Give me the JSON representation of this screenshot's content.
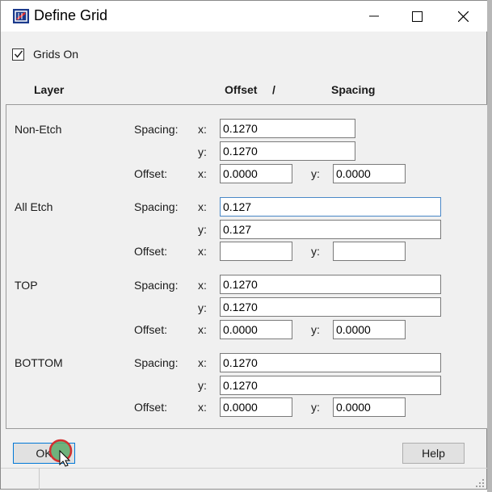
{
  "window": {
    "title": "Define Grid"
  },
  "grids_on": {
    "label": "Grids On",
    "checked": true
  },
  "headers": {
    "layer": "Layer",
    "offset": "Offset",
    "slash": "/",
    "spacing": "Spacing"
  },
  "labels": {
    "spacing": "Spacing:",
    "offset": "Offset:",
    "x": "x:",
    "y": "y:"
  },
  "layers": [
    {
      "name": "Non-Etch",
      "spacing_x": "0.1270",
      "spacing_y": "0.1270",
      "offset_x": "0.0000",
      "offset_y": "0.0000"
    },
    {
      "name": "All Etch",
      "spacing_x": "0.127",
      "spacing_y": "0.127",
      "offset_x": "",
      "offset_y": ""
    },
    {
      "name": "TOP",
      "spacing_x": "0.1270",
      "spacing_y": "0.1270",
      "offset_x": "0.0000",
      "offset_y": "0.0000"
    },
    {
      "name": "BOTTOM",
      "spacing_x": "0.1270",
      "spacing_y": "0.1270",
      "offset_x": "0.0000",
      "offset_y": "0.0000"
    }
  ],
  "buttons": {
    "ok": "OK",
    "help": "Help"
  },
  "icons": [
    "app-icon",
    "minimize-icon",
    "maximize-icon",
    "close-icon",
    "checkmark-icon",
    "mouse-cursor-icon",
    "resize-grip-icon"
  ],
  "colors": {
    "focus_border": "#4a88c7",
    "cursor_highlight": "#5aa96a",
    "cursor_ring": "#d23030"
  }
}
